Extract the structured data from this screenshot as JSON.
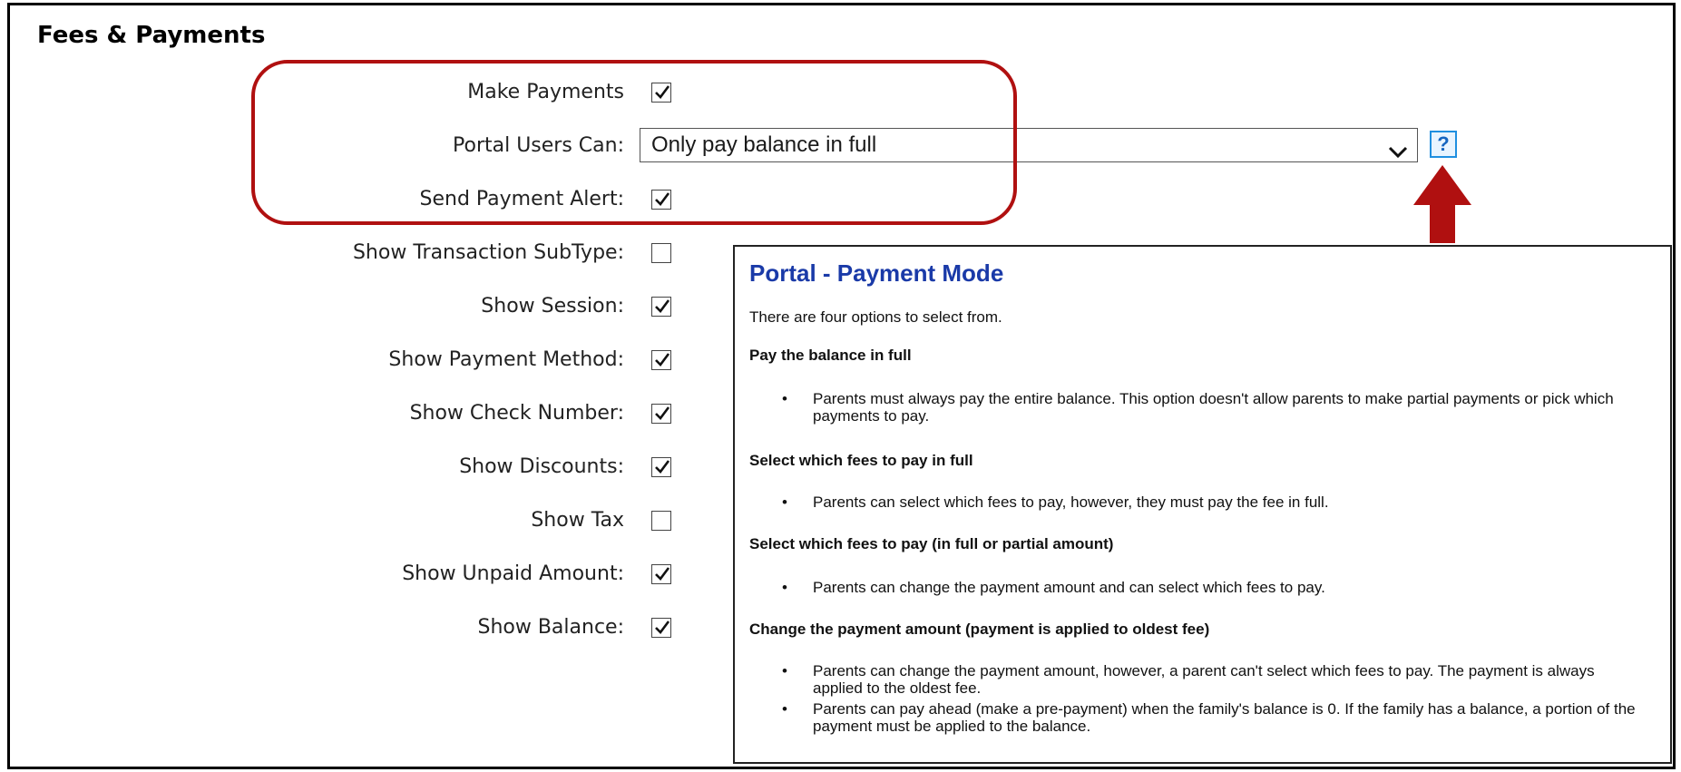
{
  "section": {
    "title": "Fees & Payments"
  },
  "form": {
    "make_payments": {
      "label": "Make Payments",
      "checked": true
    },
    "portal_users_can": {
      "label": "Portal Users Can:",
      "selected": "Only pay balance in full"
    },
    "send_payment_alert": {
      "label": "Send Payment Alert:",
      "checked": true
    },
    "show_transaction_subtype": {
      "label": "Show Transaction SubType:",
      "checked": false
    },
    "show_session": {
      "label": "Show Session:",
      "checked": true
    },
    "show_payment_method": {
      "label": "Show Payment Method:",
      "checked": true
    },
    "show_check_number": {
      "label": "Show Check Number:",
      "checked": true
    },
    "show_discounts": {
      "label": "Show Discounts:",
      "checked": true
    },
    "show_tax": {
      "label": "Show Tax",
      "checked": false
    },
    "show_unpaid_amount": {
      "label": "Show Unpaid Amount:",
      "checked": true
    },
    "show_balance": {
      "label": "Show Balance:",
      "checked": true
    }
  },
  "help": {
    "glyph": "?",
    "icon": "help-icon",
    "color": "#1f8fe0"
  },
  "annotation": {
    "highlight_color": "#b01010",
    "arrow_color": "#b01010"
  },
  "popup": {
    "title": "Portal - Payment Mode",
    "intro": "There are four options to select from.",
    "options": [
      {
        "heading": "Pay the balance in full",
        "bullets": [
          "Parents must always pay the entire balance. This option doesn't allow parents to make partial payments or pick which payments to pay."
        ]
      },
      {
        "heading": "Select which fees to pay in full",
        "bullets": [
          "Parents can select which fees to pay, however, they must pay the fee in full."
        ]
      },
      {
        "heading": "Select which fees to pay (in full or partial amount)",
        "bullets": [
          "Parents can change the payment amount and can select which fees to pay."
        ]
      },
      {
        "heading": "Change the payment amount (payment is applied to oldest fee)",
        "bullets": [
          "Parents can change the payment amount, however, a parent can't select which fees to pay. The payment is always applied to the oldest fee.",
          "Parents can pay ahead (make a pre-payment) when the family's balance is 0. If the family has a balance, a portion of the payment must be applied to the balance."
        ]
      }
    ]
  }
}
